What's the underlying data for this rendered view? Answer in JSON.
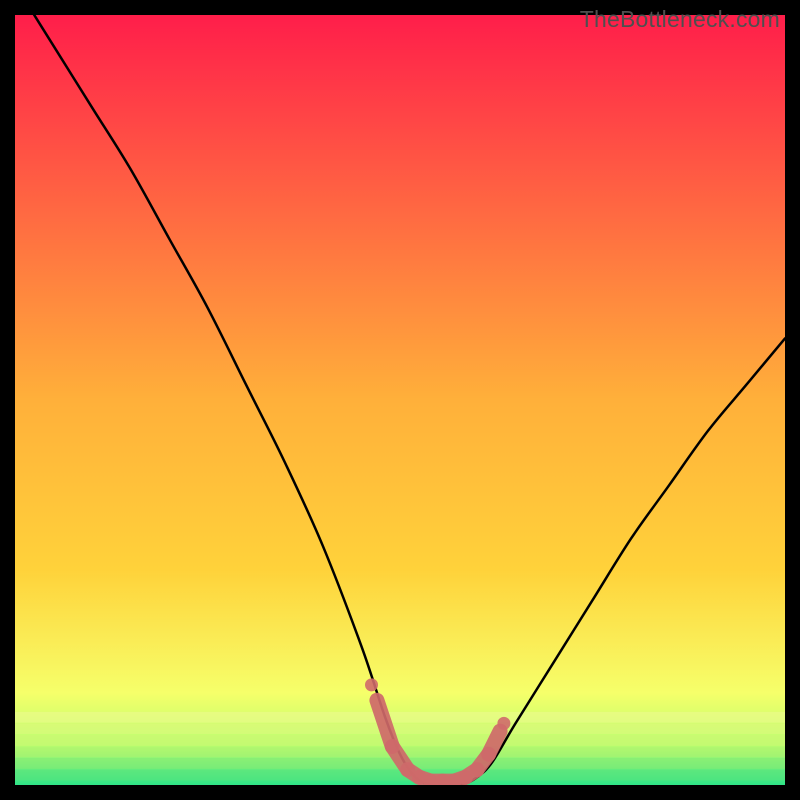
{
  "watermark": "TheBottleneck.com",
  "colors": {
    "frame_bg": "#000000",
    "gradient_top": "#ff1e4a",
    "gradient_mid": "#ffd23a",
    "gradient_lower": "#f6ff6a",
    "gradient_floor": "#2fe487",
    "curve_stroke": "#000000",
    "marker_stroke": "#cf6a6a"
  },
  "chart_data": {
    "type": "line",
    "title": "",
    "xlabel": "",
    "ylabel": "",
    "xlim": [
      0,
      100
    ],
    "ylim": [
      0,
      100
    ],
    "series": [
      {
        "name": "bottleneck-curve",
        "x": [
          0,
          5,
          10,
          15,
          20,
          25,
          30,
          35,
          40,
          45,
          48,
          50,
          52,
          54,
          56,
          58,
          60,
          62,
          65,
          70,
          75,
          80,
          85,
          90,
          95,
          100
        ],
        "y": [
          104,
          96,
          88,
          80,
          71,
          62,
          52,
          42,
          31,
          18,
          9,
          4,
          1,
          0,
          0,
          0,
          1,
          3,
          8,
          16,
          24,
          32,
          39,
          46,
          52,
          58
        ]
      }
    ],
    "markers": {
      "name": "optimal-range-highlight",
      "x": [
        47,
        49,
        51,
        52.5,
        54,
        55.5,
        57,
        58.5,
        60,
        61.5,
        63
      ],
      "y": [
        11,
        5,
        2,
        1,
        0.5,
        0.5,
        0.5,
        1,
        2,
        4,
        7
      ]
    }
  }
}
